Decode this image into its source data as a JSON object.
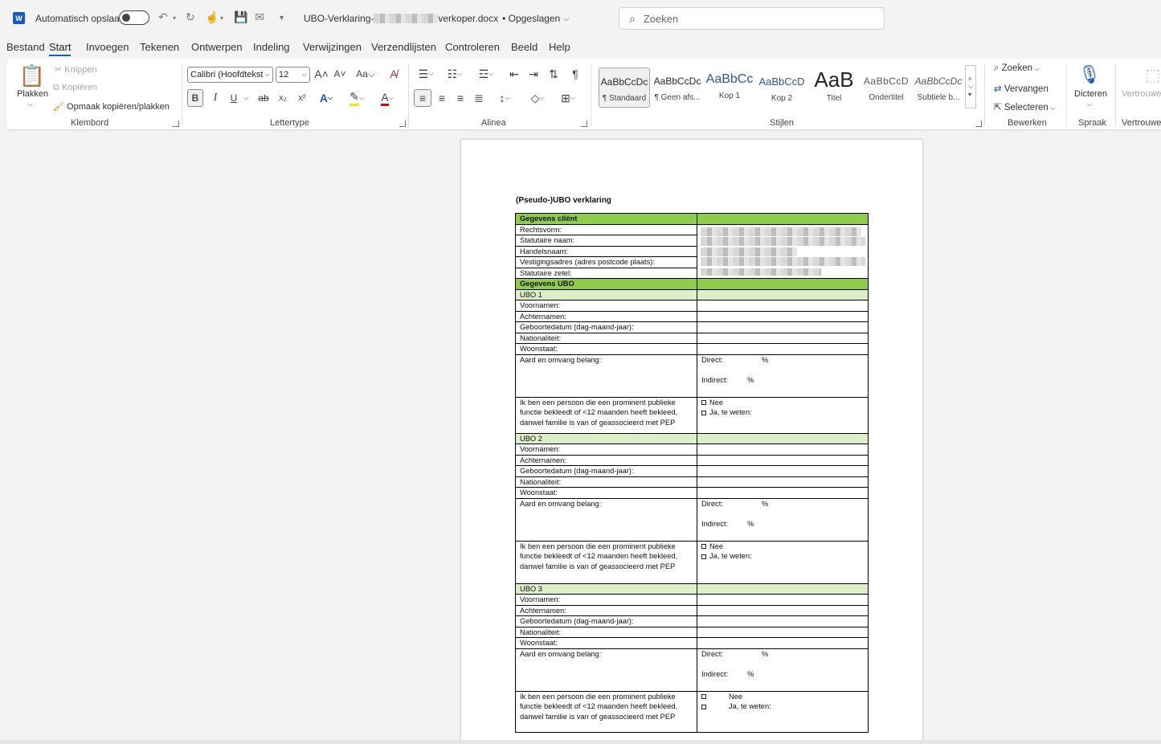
{
  "titlebar": {
    "autosave_label": "Automatisch opslaan",
    "doc_name_prefix": "UBO-Verklaring-",
    "doc_name_suffix": "verkoper.docx",
    "save_status": "• Opgeslagen",
    "search_placeholder": "Zoeken"
  },
  "tabs": [
    "Bestand",
    "Start",
    "Invoegen",
    "Tekenen",
    "Ontwerpen",
    "Indeling",
    "Verwijzingen",
    "Verzendlijsten",
    "Controleren",
    "Beeld",
    "Help"
  ],
  "ribbon": {
    "klembord": {
      "label": "Klembord",
      "paste": "Plakken",
      "cut": "Knippen",
      "copy": "Kopiëren",
      "format_painter": "Opmaak kopiëren/plakken"
    },
    "lettertype": {
      "label": "Lettertype",
      "font": "Calibri (Hoofdtekst",
      "size": "12"
    },
    "alinea": {
      "label": "Alinea"
    },
    "stijlen": {
      "label": "Stijlen",
      "styles": [
        {
          "preview": "AaBbCcDc",
          "name": "¶ Standaard"
        },
        {
          "preview": "AaBbCcDc",
          "name": "¶ Geen afs..."
        },
        {
          "preview": "AaBbCc",
          "name": "Kop 1"
        },
        {
          "preview": "AaBbCcD",
          "name": "Kop 2"
        },
        {
          "preview": "AaB",
          "name": "Titel"
        },
        {
          "preview": "AaBbCcD",
          "name": "Ondertitel"
        },
        {
          "preview": "AaBbCcDc",
          "name": "Subtiele b..."
        }
      ]
    },
    "bewerken": {
      "label": "Bewerken",
      "find": "Zoeken",
      "replace": "Vervangen",
      "select": "Selecteren"
    },
    "spraak": {
      "label": "Spraak",
      "dictate": "Dicteren"
    },
    "vertrouwelijkheid": {
      "label": "Vertrouwe",
      "btn": "Vertrouwe"
    }
  },
  "document": {
    "title": "(Pseudo-)UBO verklaring",
    "client_header": "Gegevens cliënt",
    "client_fields": [
      "Rechtsvorm:",
      "Statutaire naam:",
      "Handelsnaam:",
      "Vestigingsadres (adres postcode plaats):",
      "Statutaire zetel:"
    ],
    "ubo_header": "Gegevens UBO",
    "ubo_fields": [
      "Voornamen:",
      "Achternamen:",
      "Geboortedatum (dag-maand-jaar):",
      "Nationaliteit:",
      "Woonstaat:"
    ],
    "interest_label": "Aard en omvang belang:",
    "direct": "Direct:",
    "indirect": "Indirect:",
    "percent": "%",
    "pep_text": "Ik ben een persoon die een prominent publieke functie bekleedt of <12 maanden heeft bekleed, danwel familie is van of geassocieerd met PEP",
    "no": "Nee",
    "yes": "Ja, te weten:",
    "ubos": [
      "UBO 1",
      "UBO 2",
      "UBO 3"
    ],
    "colors": {
      "header_green": "#8fcb4c",
      "light_green": "#dcefc7"
    }
  }
}
